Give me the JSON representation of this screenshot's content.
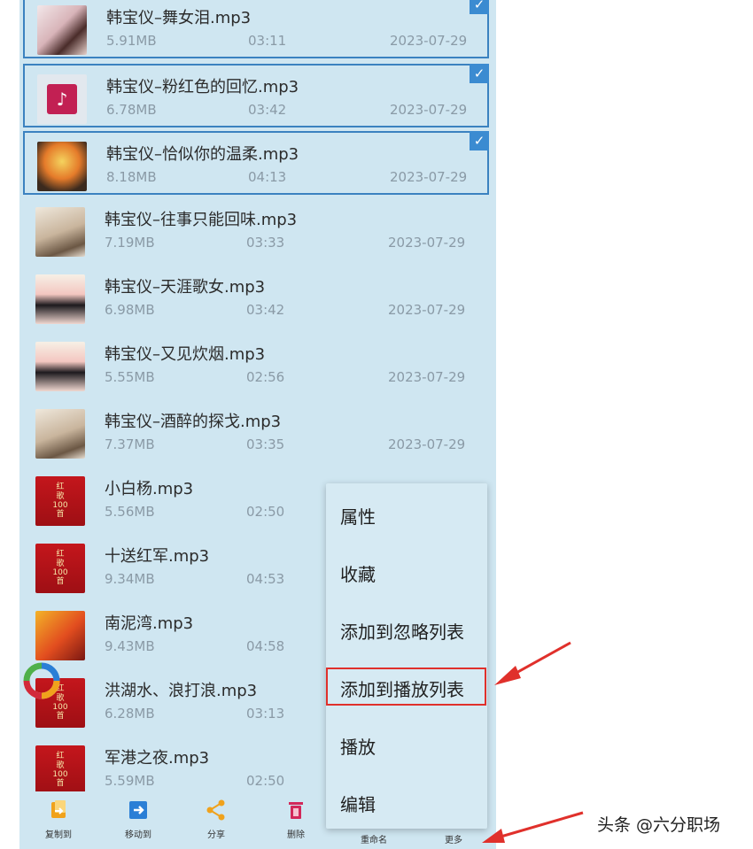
{
  "files": [
    {
      "name": "韩宝仪–舞女泪.mp3",
      "size": "5.91MB",
      "duration": "03:11",
      "date": "2023-07-29",
      "selected": true
    },
    {
      "name": "韩宝仪–粉红色的回忆.mp3",
      "size": "6.78MB",
      "duration": "03:42",
      "date": "2023-07-29",
      "selected": true
    },
    {
      "name": "韩宝仪–恰似你的温柔.mp3",
      "size": "8.18MB",
      "duration": "04:13",
      "date": "2023-07-29",
      "selected": true
    },
    {
      "name": "韩宝仪–往事只能回味.mp3",
      "size": "7.19MB",
      "duration": "03:33",
      "date": "2023-07-29",
      "selected": false
    },
    {
      "name": "韩宝仪–天涯歌女.mp3",
      "size": "6.98MB",
      "duration": "03:42",
      "date": "2023-07-29",
      "selected": false
    },
    {
      "name": "韩宝仪–又见炊烟.mp3",
      "size": "5.55MB",
      "duration": "02:56",
      "date": "2023-07-29",
      "selected": false
    },
    {
      "name": "韩宝仪–酒醉的探戈.mp3",
      "size": "7.37MB",
      "duration": "03:35",
      "date": "2023-07-29",
      "selected": false
    },
    {
      "name": "小白杨.mp3",
      "size": "5.56MB",
      "duration": "02:50",
      "date": "",
      "selected": false
    },
    {
      "name": "十送红军.mp3",
      "size": "9.34MB",
      "duration": "04:53",
      "date": "",
      "selected": false
    },
    {
      "name": "南泥湾.mp3",
      "size": "9.43MB",
      "duration": "04:58",
      "date": "",
      "selected": false
    },
    {
      "name": "洪湖水、浪打浪.mp3",
      "size": "6.28MB",
      "duration": "03:13",
      "date": "",
      "selected": false
    },
    {
      "name": "军港之夜.mp3",
      "size": "5.59MB",
      "duration": "02:50",
      "date": "",
      "selected": false
    }
  ],
  "context_menu": {
    "items": [
      "属性",
      "收藏",
      "添加到忽略列表",
      "添加到播放列表",
      "播放",
      "编辑"
    ],
    "highlighted": "添加到播放列表"
  },
  "toolbar": {
    "copy_label": "复制到",
    "move_label": "移动到",
    "share_label": "分享",
    "delete_label": "删除",
    "rename_label": "重命名",
    "more_label": "更多"
  },
  "album_text": {
    "red_cover_line1": "红",
    "red_cover_line2": "歌",
    "red_cover_line3": "100",
    "red_cover_line4": "首"
  },
  "watermark": "头条 @六分职场",
  "colors": {
    "background": "#cfe6f1",
    "selection_border": "#3b82c0",
    "check": "#3b8bd1",
    "highlight_box": "#e0302b",
    "arrow": "#e0302b"
  },
  "icons": {
    "check": "checkmark-icon",
    "note": "music-note-icon",
    "copy": "copy-to-icon",
    "move": "move-to-icon",
    "share": "share-icon",
    "delete": "trash-icon"
  }
}
